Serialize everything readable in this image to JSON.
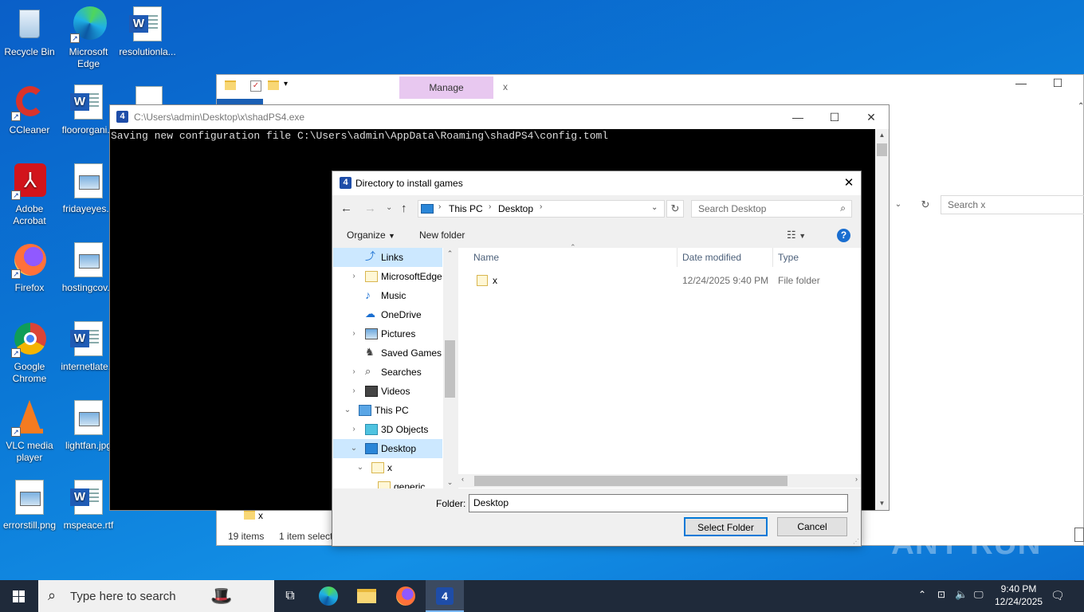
{
  "desktop": {
    "icons": [
      {
        "label": "Recycle Bin"
      },
      {
        "label": "Microsoft Edge"
      },
      {
        "label": "resolutionla..."
      },
      {
        "label": "CCleaner"
      },
      {
        "label": "floororgani..."
      },
      {
        "label": "Adobe Acrobat"
      },
      {
        "label": "fridayeyes..."
      },
      {
        "label": "Firefox"
      },
      {
        "label": "hostingcov..."
      },
      {
        "label": "Google Chrome"
      },
      {
        "label": "internetlate..."
      },
      {
        "label": "VLC media player"
      },
      {
        "label": "lightfan.jpg"
      },
      {
        "label": "errorstill.png"
      },
      {
        "label": "mspeace.rtf"
      }
    ]
  },
  "explorer": {
    "ribbon_tab": "Manage",
    "title_x": "x",
    "search_placeholder": "Search x",
    "folder_row": "x",
    "status_items": "19 items",
    "status_selected": "1 item select"
  },
  "console": {
    "title": "C:\\Users\\admin\\Desktop\\x\\shadPS4.exe",
    "output": "Saving new configuration file C:\\Users\\admin\\AppData\\Roaming\\shadPS4\\config.toml"
  },
  "dialog": {
    "title": "Directory to install games",
    "breadcrumb": [
      "This PC",
      "Desktop"
    ],
    "search_placeholder": "Search Desktop",
    "organize_label": "Organize",
    "new_folder_label": "New folder",
    "nav_items": [
      {
        "label": "Links"
      },
      {
        "label": "MicrosoftEdge"
      },
      {
        "label": "Music"
      },
      {
        "label": "OneDrive"
      },
      {
        "label": "Pictures"
      },
      {
        "label": "Saved Games"
      },
      {
        "label": "Searches"
      },
      {
        "label": "Videos"
      },
      {
        "label": "This PC"
      },
      {
        "label": "3D Objects"
      },
      {
        "label": "Desktop"
      },
      {
        "label": "x"
      },
      {
        "label": "generic"
      }
    ],
    "columns": {
      "name": "Name",
      "date": "Date modified",
      "type": "Type"
    },
    "files": [
      {
        "name": "x",
        "date": "12/24/2025 9:40 PM",
        "type": "File folder"
      }
    ],
    "folder_label": "Folder:",
    "folder_value": "Desktop",
    "select_button": "Select Folder",
    "cancel_button": "Cancel"
  },
  "taskbar": {
    "search_placeholder": "Type here to search",
    "time": "9:40 PM",
    "date": "12/24/2025"
  },
  "watermark": "ANY RUN"
}
